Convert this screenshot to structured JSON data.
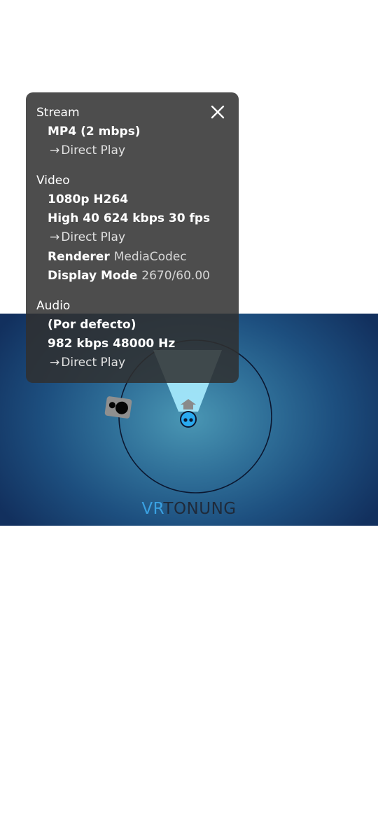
{
  "video": {
    "logo_prefix": "VR",
    "logo_rest": "TONUNG"
  },
  "stats": {
    "stream": {
      "title": "Stream",
      "format": "MP4 (2 mbps)",
      "play_method": "Direct Play"
    },
    "video": {
      "title": "Video",
      "resolution_codec": "1080p H264",
      "profile": "High 40 624 kbps 30 fps",
      "play_method": "Direct Play",
      "renderer_label": "Renderer",
      "renderer_value": "MediaCodec",
      "display_mode_label": "Display Mode",
      "display_mode_value": "2670/60.00"
    },
    "audio": {
      "title": "Audio",
      "track": "(Por defecto)",
      "bitrate": "982 kbps 48000 Hz",
      "play_method": "Direct Play"
    },
    "arrow_glyph": "→",
    "close_icon": "close-icon"
  },
  "colors": {
    "panel_bg": "#303030",
    "logo_accent": "#3aa1e2",
    "character_blue": "#29aaf0"
  }
}
